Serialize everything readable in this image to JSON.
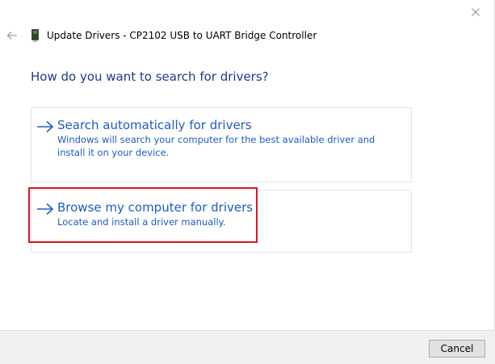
{
  "window": {
    "title": "Update Drivers - CP2102 USB to UART Bridge Controller",
    "close_icon": "close-icon",
    "back_icon": "back-arrow-icon",
    "device_icon": "usb-device-icon"
  },
  "main": {
    "heading": "How do you want to search for drivers?",
    "options": [
      {
        "title": "Search automatically for drivers",
        "description": "Windows will search your computer for the best available driver and install it on your device.",
        "icon": "arrow-right-icon"
      },
      {
        "title": "Browse my computer for drivers",
        "description": "Locate and install a driver manually.",
        "icon": "arrow-right-icon",
        "highlighted": true
      }
    ]
  },
  "footer": {
    "cancel_label": "Cancel"
  },
  "colors": {
    "link_blue": "#1f5bc6",
    "heading_blue": "#1c3b8a",
    "highlight_red": "#e0141e",
    "footer_bg": "#f0f0f0"
  }
}
